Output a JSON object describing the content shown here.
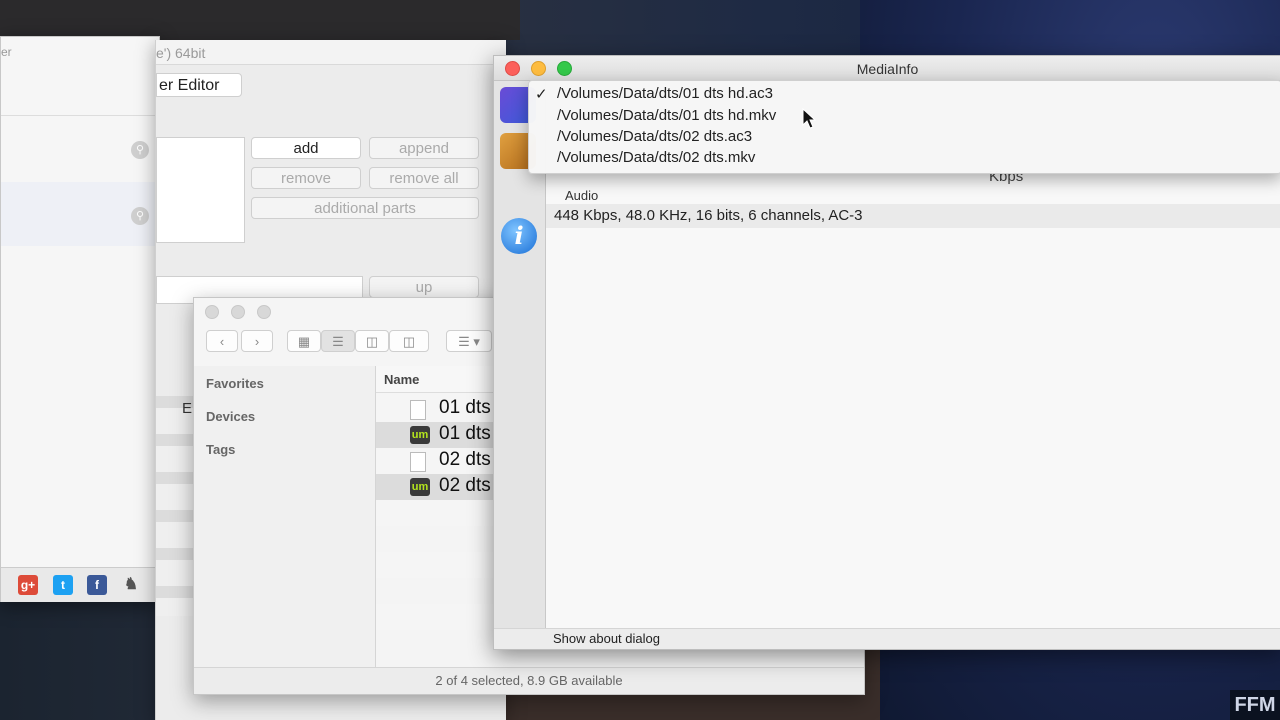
{
  "left_window": {
    "title_fragment": "er"
  },
  "editor_window": {
    "title_fragment": "e') 64bit",
    "tab_label": "er Editor",
    "buttons": {
      "add": "add",
      "append": "append",
      "remove": "remove",
      "remove_all": "remove all",
      "additional_parts": "additional parts",
      "up": "up"
    },
    "column_header_fragment": "E"
  },
  "finder_window": {
    "sidebar": [
      "Favorites",
      "Devices",
      "Tags"
    ],
    "column_header": "Name",
    "files": [
      {
        "name": "01 dts",
        "icon": "document-icon",
        "selected": false
      },
      {
        "name": "01 dts",
        "icon": "um-app-icon",
        "selected": true
      },
      {
        "name": "02 dts",
        "icon": "document-icon",
        "selected": false
      },
      {
        "name": "02 dts",
        "icon": "um-app-icon",
        "selected": true
      }
    ],
    "status": "2 of 4 selected, 8.9 GB available"
  },
  "mediainfo_window": {
    "title": "MediaInfo",
    "partial_label": "Kbps",
    "section_label": "Audio",
    "info_line": "448 Kbps, 48.0 KHz, 16 bits, 6 channels, AC-3",
    "about_button": "Show about dialog",
    "traffic_light_colors": {
      "close": "#fc605b",
      "minimize": "#fdbc40",
      "zoom": "#34c84a"
    }
  },
  "file_menu": {
    "checkmark": "✓",
    "items": [
      "/Volumes/Data/dts/01 dts hd.ac3",
      "/Volumes/Data/dts/01 dts hd.mkv",
      "/Volumes/Data/dts/02 dts.ac3",
      "/Volumes/Data/dts/02 dts.mkv"
    ],
    "checked_index": 0
  },
  "watermark": "FFM"
}
